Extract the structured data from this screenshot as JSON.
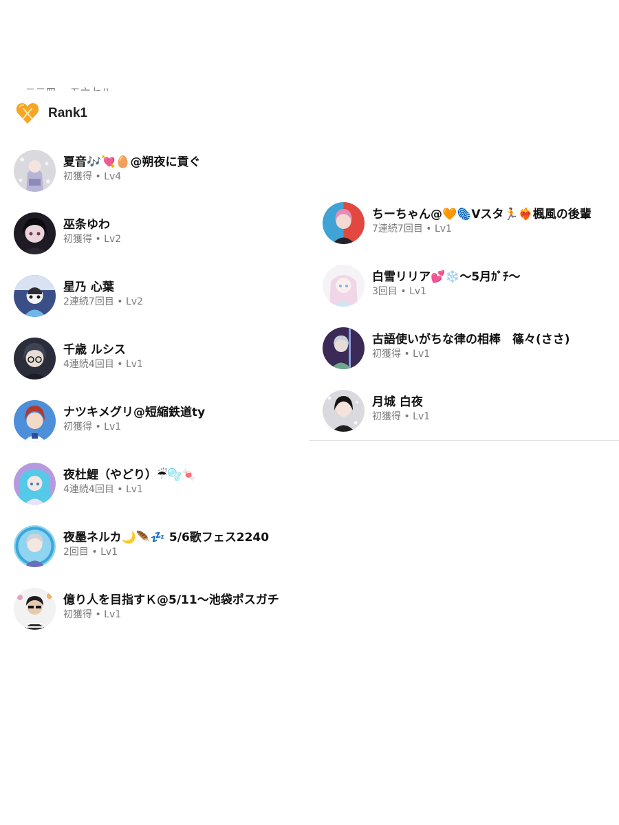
{
  "rank": {
    "title": "Rank1",
    "badge_icon": "orange-heart-rank-icon",
    "badge_color": "#f5a623"
  },
  "cutoff_text": "一二三四 • 五六七八",
  "left_list": [
    {
      "name": "夏音🎶💘🥚@朔夜に貢ぐ",
      "sub": "初獲得 • Lv4"
    },
    {
      "name": "巫条ゆわ",
      "sub": "初獲得 • Lv2"
    },
    {
      "name": "星乃 心葉",
      "sub": "2連続7回目 • Lv2"
    },
    {
      "name": "千歳 ルシス",
      "sub": "4連続4回目 • Lv1"
    },
    {
      "name": "ナツキメグリ@短縮鉄道ty",
      "sub": "初獲得 • Lv1"
    },
    {
      "name": "夜杜鯉（やどり）☔🫧🍬",
      "sub": "4連続4回目 • Lv1"
    },
    {
      "name": "夜墨ネルカ🌙🪶💤 5/6歌フェス2240",
      "sub": "2回目 • Lv1"
    },
    {
      "name": "億り人を目指すＫ@5/11〜池袋ポスガチ",
      "sub": "初獲得 • Lv1"
    }
  ],
  "right_list": [
    {
      "name": "ちーちゃん@🧡🫆Vスタ🏃❤️‍🔥楓風の後輩",
      "sub": "7連続7回目 • Lv1"
    },
    {
      "name": "白雪リリア💕❄️〜5月ｶﾞﾁ〜",
      "sub": "3回目 • Lv1"
    },
    {
      "name": "古語使いがちな律の相棒　篠々(ささ)",
      "sub": "初獲得 • Lv1"
    },
    {
      "name": "月城 白夜",
      "sub": "初獲得 • Lv1"
    }
  ]
}
